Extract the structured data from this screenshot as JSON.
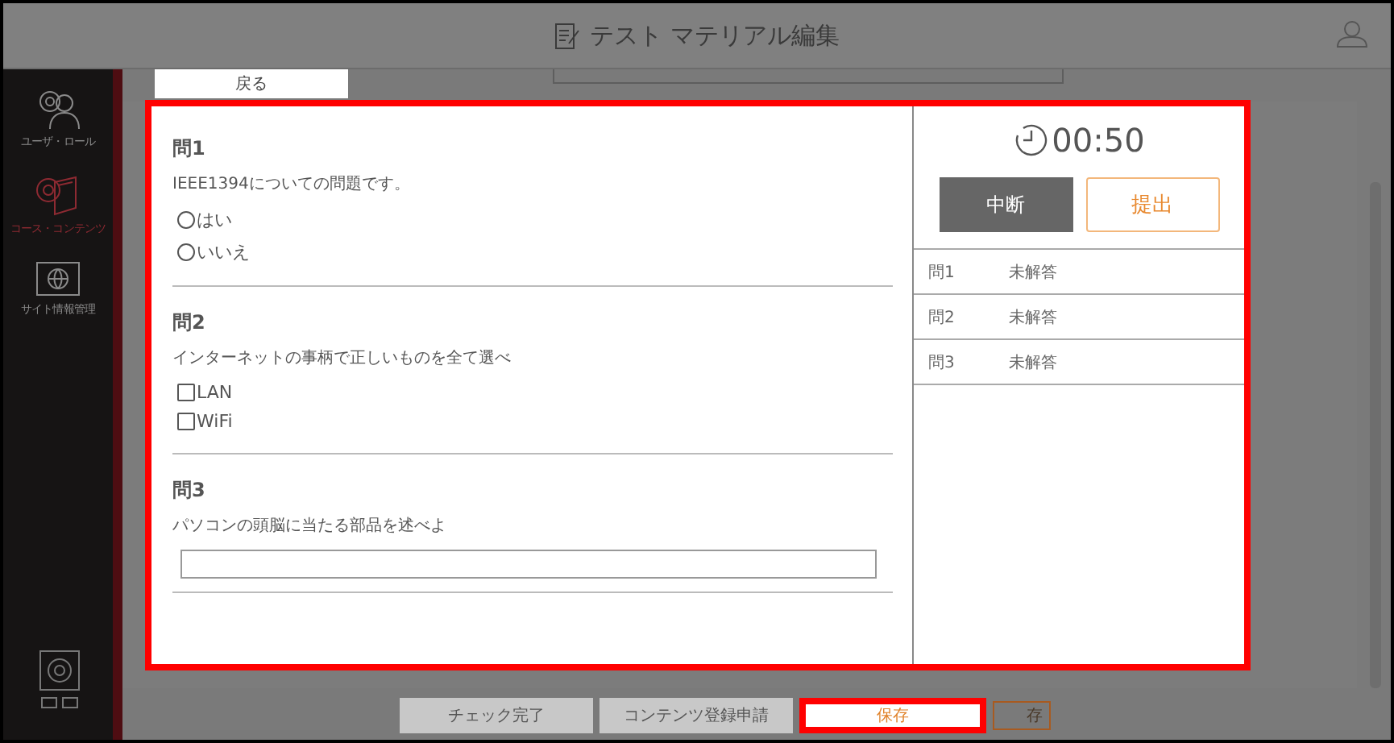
{
  "header": {
    "title": "テスト マテリアル編集"
  },
  "sidebar": {
    "items": [
      {
        "label": "ユーザ・ロール",
        "kind": "users",
        "selected": false
      },
      {
        "label": "コース・コンテンツ",
        "kind": "course",
        "selected": true
      },
      {
        "label": "サイト情報管理",
        "kind": "site",
        "selected": false
      }
    ]
  },
  "back_tab": {
    "label": "戻る"
  },
  "footer_buttons": [
    {
      "label": "チェック完了",
      "kind": "plain",
      "highlighted": false
    },
    {
      "label": "コンテンツ登録申請",
      "kind": "plain",
      "highlighted": false
    },
    {
      "label": "保存",
      "kind": "save",
      "highlighted": true
    },
    {
      "label": "存",
      "kind": "outline",
      "highlighted": false
    }
  ],
  "quiz_dialog": {
    "highlighted": true,
    "questions": [
      {
        "title": "問1",
        "text": "IEEE1394についての問題です。",
        "kind": "radio",
        "options": [
          {
            "label": "はい",
            "checked": false
          },
          {
            "label": "いいえ",
            "checked": false
          }
        ]
      },
      {
        "title": "問2",
        "text": "インターネットの事柄で正しいものを全て選べ",
        "kind": "checkbox",
        "options": [
          {
            "label": "LAN",
            "checked": false
          },
          {
            "label": "WiFi",
            "checked": false
          }
        ]
      },
      {
        "title": "問3",
        "text": "パソコンの頭脳に当たる部品を述べよ",
        "kind": "text"
      }
    ],
    "timer": "00:50",
    "pause_button": "中断",
    "submit_button": "提出",
    "status": [
      {
        "question": "問1",
        "state": "未解答"
      },
      {
        "question": "問2",
        "state": "未解答"
      },
      {
        "question": "問3",
        "state": "未解答"
      }
    ]
  }
}
